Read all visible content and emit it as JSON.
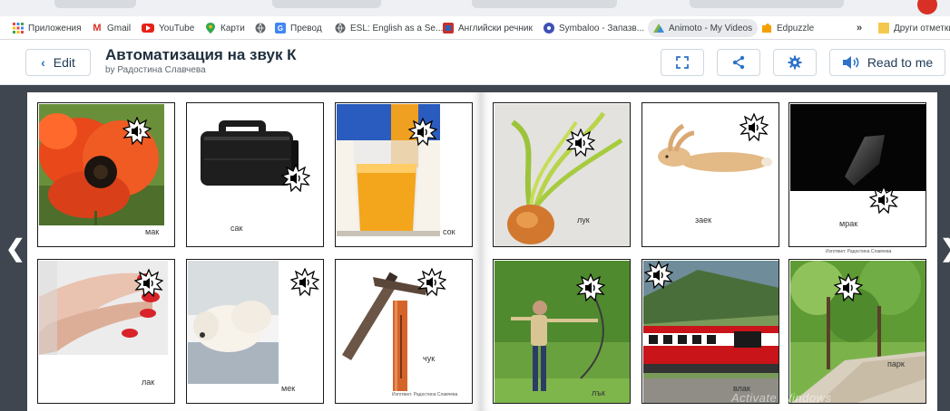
{
  "bookmarks": {
    "items": [
      {
        "label": "Приложения",
        "icon": "apps-grid-icon"
      },
      {
        "label": "Gmail",
        "icon": "gmail-icon"
      },
      {
        "label": "YouTube",
        "icon": "youtube-icon"
      },
      {
        "label": "Карти",
        "icon": "maps-pin-icon"
      },
      {
        "label": "",
        "icon": "globe-icon"
      },
      {
        "label": "Превод",
        "icon": "translate-icon"
      },
      {
        "label": "ESL: English as a Se...",
        "icon": "globe-icon"
      },
      {
        "label": "Английски речник",
        "icon": "dictionary-icon"
      },
      {
        "label": "Symbaloo - Запазв...",
        "icon": "symbaloo-icon"
      },
      {
        "label": "Animoto - My Videos",
        "icon": "animoto-icon"
      },
      {
        "label": "Edpuzzle",
        "icon": "edpuzzle-icon"
      }
    ],
    "overflow": "»",
    "other": "Други отметки"
  },
  "header": {
    "edit_label": "Edit",
    "title": "Автоматизация на звук К",
    "author": "by Радостина Славчева",
    "read_label": "Read to me"
  },
  "book": {
    "left_page": [
      {
        "word": "мак",
        "image": "red-poppy-flower"
      },
      {
        "word": "сак",
        "image": "black-briefcase"
      },
      {
        "word": "сок",
        "image": "glass-of-orange-juice"
      },
      {
        "word": "лак",
        "image": "hand-with-red-nail-polish"
      },
      {
        "word": "мек",
        "image": "fluffy-white-dog"
      },
      {
        "word": "чук",
        "image": "hammer"
      }
    ],
    "right_page": [
      {
        "word": "лук",
        "image": "onion-with-sprouts"
      },
      {
        "word": "заек",
        "image": "lying-rabbit"
      },
      {
        "word": "мрак",
        "image": "darkness-with-moon"
      },
      {
        "word": "лък",
        "image": "woman-archer-with-bow"
      },
      {
        "word": "влак",
        "image": "red-train"
      },
      {
        "word": "парк",
        "image": "green-park-path"
      }
    ],
    "credit": "Изготвил: Радостина Славчева"
  },
  "colors": {
    "stage_bg": "#3f464f",
    "accent_blue": "#2d73c8",
    "text_dark": "#1f2e3d"
  },
  "watermark": "Activate Windows"
}
